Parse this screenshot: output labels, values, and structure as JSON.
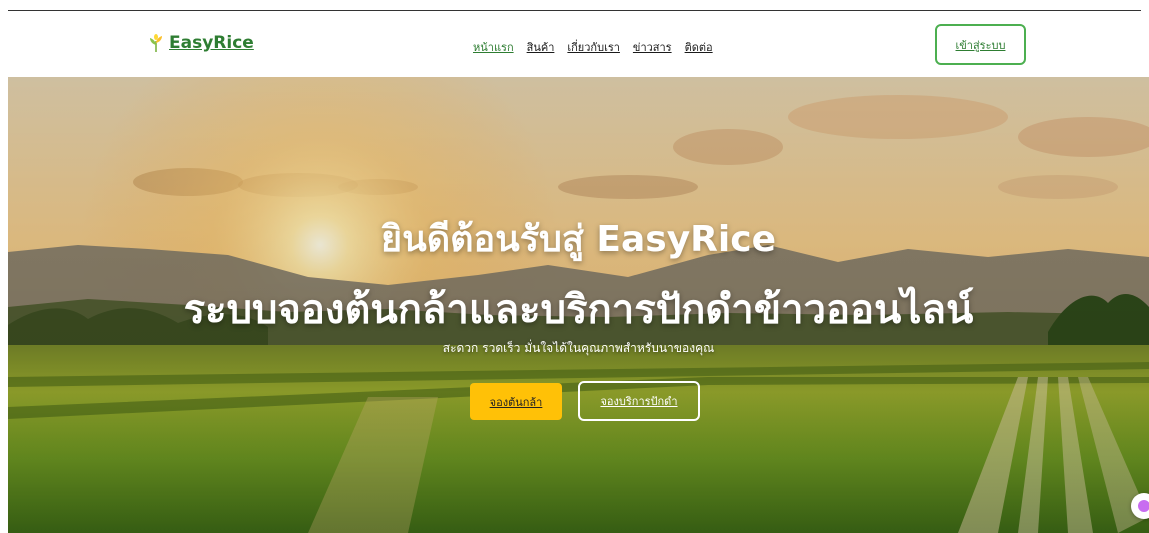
{
  "brand": {
    "name": "EasyRice",
    "logo_icon": "rice-sprout-icon",
    "color": "#2e7d32"
  },
  "nav": {
    "items": [
      {
        "label": "หน้าแรก",
        "active": true
      },
      {
        "label": "สินค้า",
        "active": false
      },
      {
        "label": "เกี่ยวกับเรา",
        "active": false
      },
      {
        "label": "ข่าวสาร",
        "active": false
      },
      {
        "label": "ติดต่อ",
        "active": false
      }
    ]
  },
  "header": {
    "login_label": "เข้าสู่ระบบ"
  },
  "hero": {
    "title_line1": "ยินดีต้อนรับสู่ EasyRice",
    "title_line2": "ระบบจองต้นกล้าและบริการปักดำข้าวออนไลน์",
    "subtitle": "สะดวก รวดเร็ว มั่นใจได้ในคุณภาพสำหรับนาของคุณ",
    "primary_button": "จองต้นกล้า",
    "secondary_button": "จองบริการปักดำ"
  },
  "colors": {
    "accent_yellow": "#ffc107",
    "accent_green": "#4caf50"
  },
  "chat_widget": {
    "icon": "chat-bubble-icon"
  }
}
